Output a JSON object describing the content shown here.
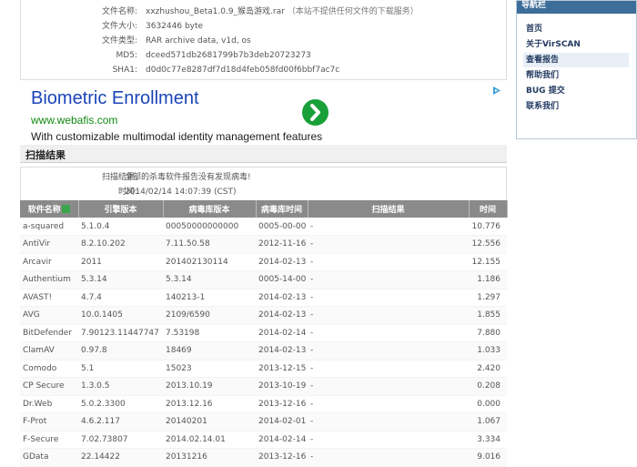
{
  "file_info": [
    {
      "label": "文件名称:",
      "value": "xxzhushou_Beta1.0.9_猴岛游戏.rar",
      "note": "（本站不提供任何文件的下载服务）"
    },
    {
      "label": "文件大小:",
      "value": "3632446 byte"
    },
    {
      "label": "文件类型:",
      "value": "RAR archive data, v1d, os"
    },
    {
      "label": "MD5:",
      "value": "dceed571db2681799b7b3deb20723273"
    },
    {
      "label": "SHA1:",
      "value": "d0d0c77e8287df7d18d4feb058fd00f6bbf7ac7c"
    }
  ],
  "ad": {
    "title": "Biometric Enrollment",
    "url": "www.webafis.com",
    "description": "With customizable multimodal identity management features",
    "button_color": "#19a038"
  },
  "section": {
    "title": "扫描结果"
  },
  "summary": {
    "result_label": "扫描结果:",
    "result_value": "全部的杀毒软件报告没有发现病毒!",
    "time_label": "时间:",
    "time_value": "2014/02/14 14:07:39 (CST)"
  },
  "table": {
    "headers": [
      "软件名称",
      "引擎版本",
      "病毒库版本",
      "病毒库时间",
      "扫描结果",
      "时间"
    ],
    "rows": [
      [
        "a-squared",
        "5.1.0.4",
        "00050000000000",
        "0005-00-00",
        "-",
        "10.776"
      ],
      [
        "AntiVir",
        "8.2.10.202",
        "7.11.50.58",
        "2012-11-16",
        "-",
        "12.556"
      ],
      [
        "Arcavir",
        "2011",
        "201402130114",
        "2014-02-13",
        "-",
        "12.155"
      ],
      [
        "Authentium",
        "5.3.14",
        "5.3.14",
        "0005-14-00",
        "-",
        "1.186"
      ],
      [
        "AVAST!",
        "4.7.4",
        "140213-1",
        "2014-02-13",
        "-",
        "1.297"
      ],
      [
        "AVG",
        "10.0.1405",
        "2109/6590",
        "2014-02-13",
        "-",
        "1.855"
      ],
      [
        "BitDefender",
        "7.90123.11447747",
        "7.53198",
        "2014-02-14",
        "-",
        "7.880"
      ],
      [
        "ClamAV",
        "0.97.8",
        "18469",
        "2014-02-13",
        "-",
        "1.033"
      ],
      [
        "Comodo",
        "5.1",
        "15023",
        "2013-12-15",
        "-",
        "2.420"
      ],
      [
        "CP Secure",
        "1.3.0.5",
        "2013.10.19",
        "2013-10-19",
        "-",
        "0.208"
      ],
      [
        "Dr.Web",
        "5.0.2.3300",
        "2013.12.16",
        "2013-12-16",
        "-",
        "0.000"
      ],
      [
        "F-Prot",
        "4.6.2.117",
        "20140201",
        "2014-02-01",
        "-",
        "1.067"
      ],
      [
        "F-Secure",
        "7.02.73807",
        "2014.02.14.01",
        "2014-02-14",
        "-",
        "3.334"
      ],
      [
        "GData",
        "22.14422",
        "20131216",
        "2013-12-16",
        "-",
        "9.016"
      ]
    ]
  },
  "sidebar": {
    "title": "导航栏",
    "items": [
      "首页",
      "关于VirSCAN",
      "查看报告",
      "帮助我们",
      "BUG 提交",
      "联系我们"
    ],
    "active_index": 2,
    "header_color": "#3c6e99"
  }
}
